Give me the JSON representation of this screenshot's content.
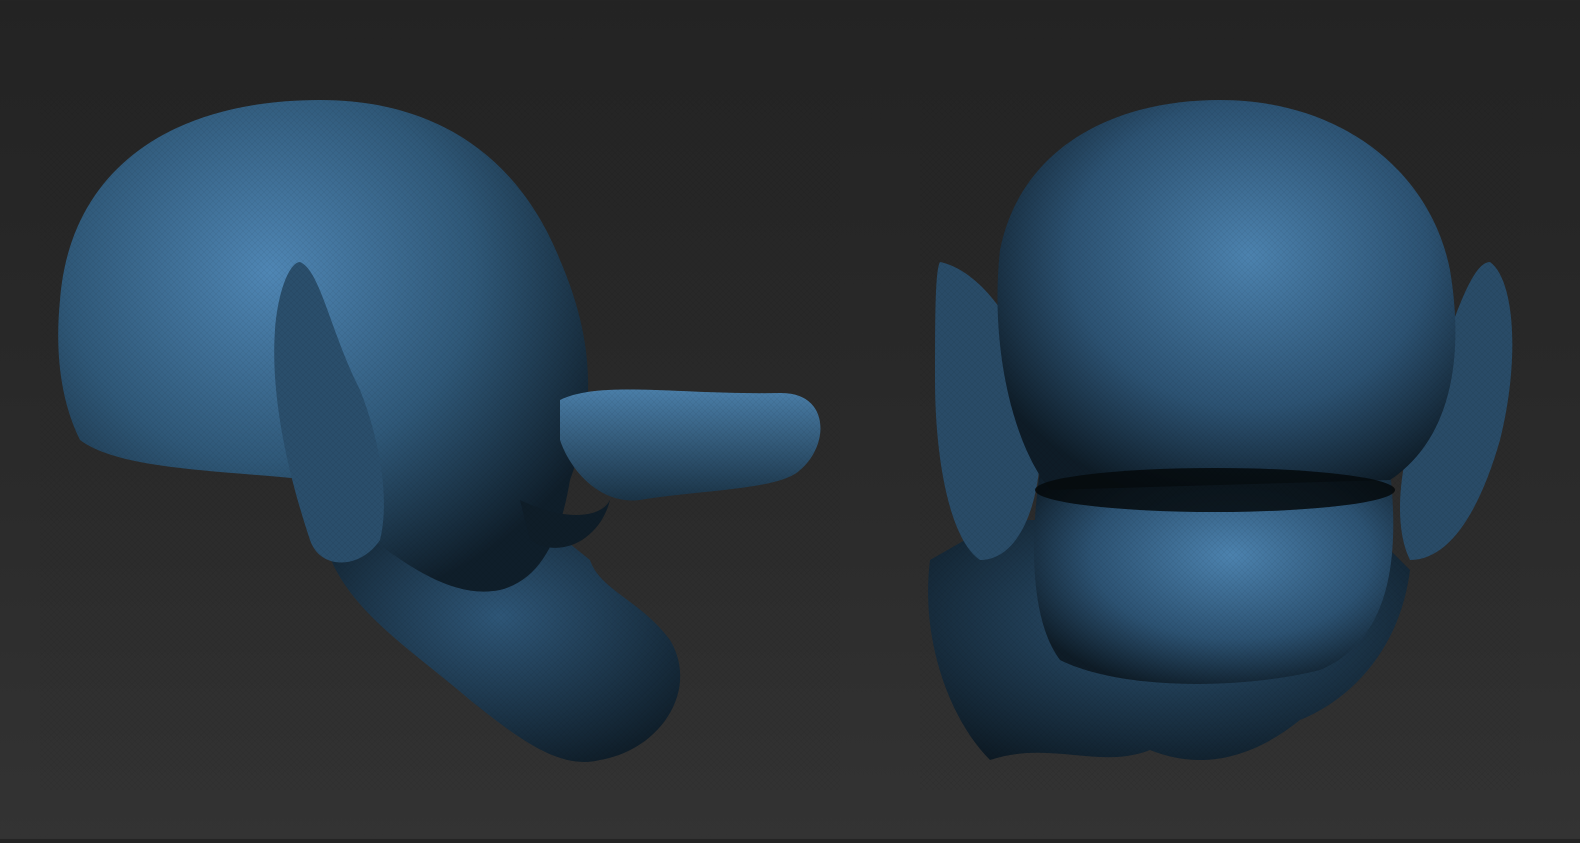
{
  "scene": {
    "colors": {
      "background_top": "#232323",
      "background_bottom": "#333333",
      "mesh_highlight": "#4f86b4",
      "mesh_mid": "#2f5878",
      "mesh_shadow": "#0d1a24"
    }
  }
}
